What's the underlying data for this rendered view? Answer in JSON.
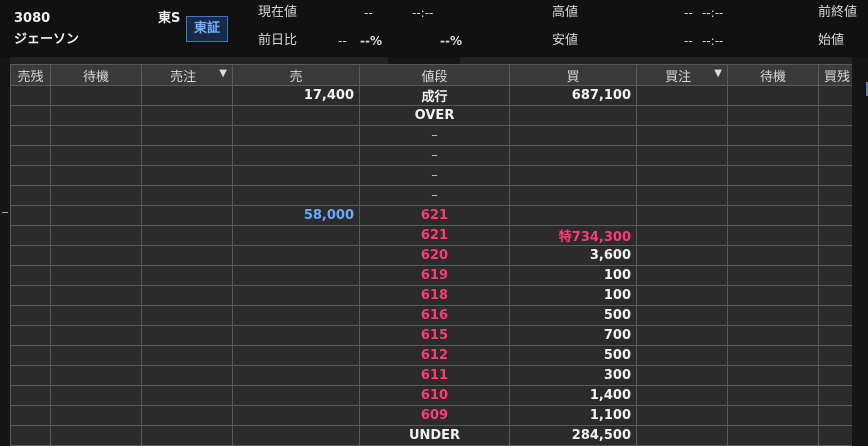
{
  "header": {
    "code": "3080",
    "name": "ジェーソン",
    "market": "東S",
    "exchange": "東証",
    "current_price_label": "現在値",
    "current_price_value": "--",
    "current_price_time": "--:--",
    "prev_diff_label": "前日比",
    "prev_diff_value": "--",
    "prev_diff_pct": "--%",
    "prev_diff_pct2": "--%",
    "high_label": "高値",
    "high_value": "--",
    "high_time": "--:--",
    "low_label": "安値",
    "low_value": "--",
    "low_time": "--:--",
    "prev_close_label": "前終値",
    "open_label": "始値"
  },
  "board": {
    "columns": [
      "売残",
      "待機",
      "売注",
      "売",
      "値段",
      "買",
      "買注",
      "待機",
      "買残"
    ],
    "rows": [
      {
        "sell": "17,400",
        "price": "成行",
        "buy": "687,100",
        "price_style": "white"
      },
      {
        "sell": "",
        "price": "OVER",
        "buy": "",
        "price_style": "white"
      },
      {
        "sell": "",
        "price": "–",
        "buy": "",
        "price_style": "dash"
      },
      {
        "sell": "",
        "price": "–",
        "buy": "",
        "price_style": "dash"
      },
      {
        "sell": "",
        "price": "–",
        "buy": "",
        "price_style": "dash"
      },
      {
        "sell": "",
        "price": "–",
        "buy": "",
        "price_style": "dash"
      },
      {
        "sell": "58,000",
        "price": "621",
        "buy": "",
        "price_style": "red",
        "sell_style": "blue"
      },
      {
        "sell": "",
        "price": "621",
        "buy": "特734,300",
        "price_style": "red",
        "buy_style": "red"
      },
      {
        "sell": "",
        "price": "620",
        "buy": "3,600",
        "price_style": "red"
      },
      {
        "sell": "",
        "price": "619",
        "buy": "100",
        "price_style": "red"
      },
      {
        "sell": "",
        "price": "618",
        "buy": "100",
        "price_style": "red"
      },
      {
        "sell": "",
        "price": "616",
        "buy": "500",
        "price_style": "red"
      },
      {
        "sell": "",
        "price": "615",
        "buy": "700",
        "price_style": "red"
      },
      {
        "sell": "",
        "price": "612",
        "buy": "500",
        "price_style": "red"
      },
      {
        "sell": "",
        "price": "611",
        "buy": "300",
        "price_style": "red"
      },
      {
        "sell": "",
        "price": "610",
        "buy": "1,400",
        "price_style": "red"
      },
      {
        "sell": "",
        "price": "609",
        "buy": "1,100",
        "price_style": "red"
      },
      {
        "sell": "",
        "price": "UNDER",
        "buy": "284,500",
        "price_style": "white"
      }
    ]
  },
  "colors": {
    "background": "#151515",
    "grid": "#5a5a5a",
    "price_red": "#ff3b73",
    "sell_blue": "#6aa9ff",
    "exchange_badge": "#3f78c8"
  }
}
